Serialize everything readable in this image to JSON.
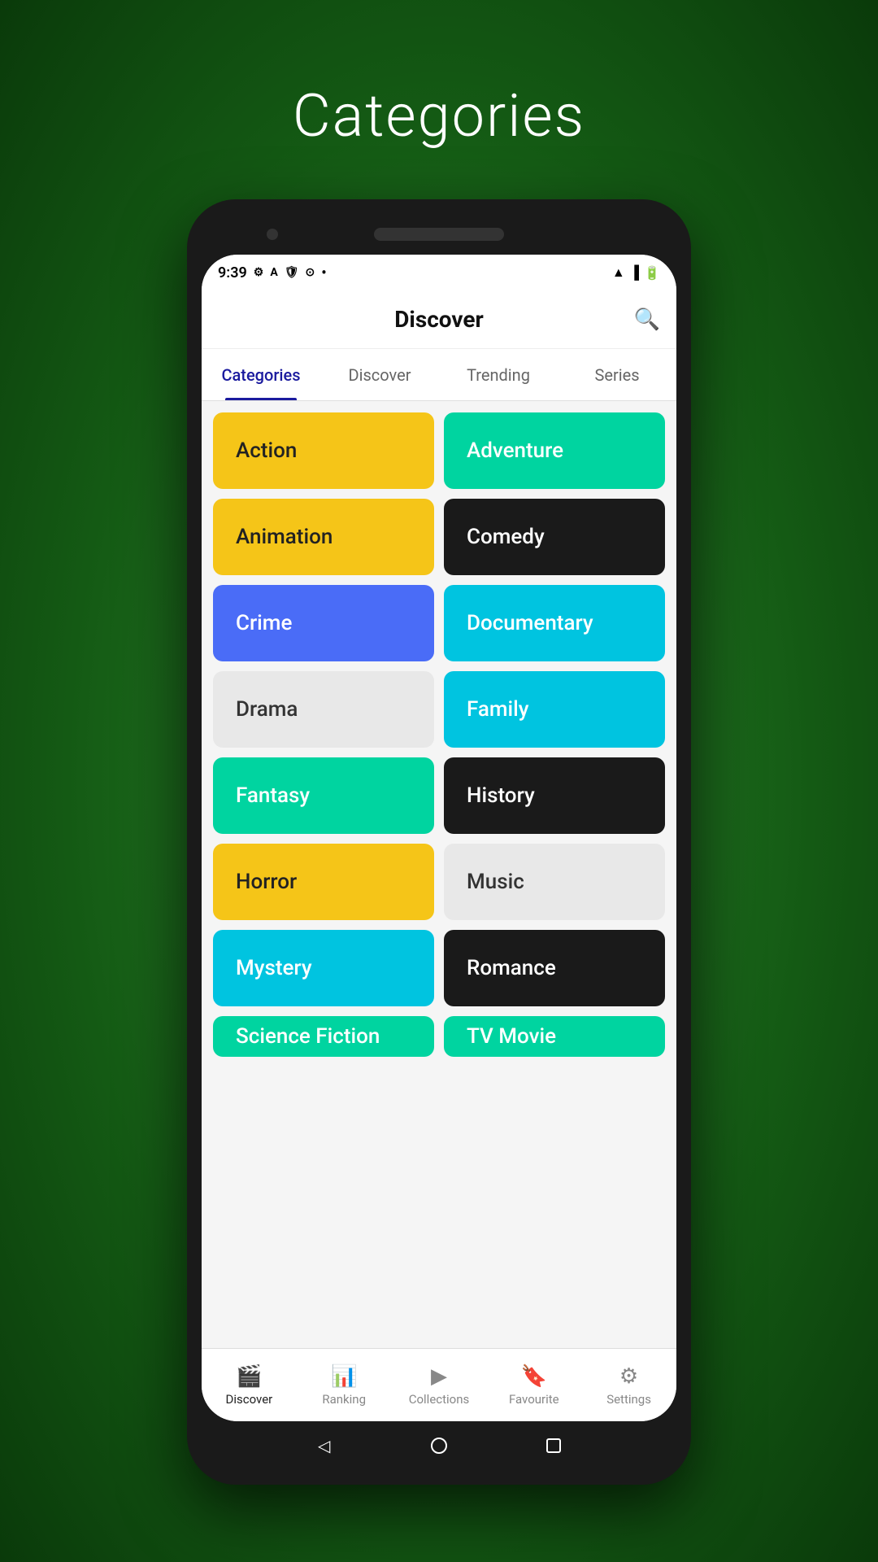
{
  "page": {
    "title": "Categories",
    "background_color": "#1a6e1a"
  },
  "app": {
    "header_title": "Discover",
    "search_icon": "🔍"
  },
  "status_bar": {
    "time": "9:39",
    "dot": "•"
  },
  "tabs": [
    {
      "label": "Categories",
      "active": true
    },
    {
      "label": "Discover",
      "active": false
    },
    {
      "label": "Trending",
      "active": false
    },
    {
      "label": "Series",
      "active": false
    }
  ],
  "categories": [
    {
      "label": "Action",
      "color_class": "yellow",
      "row": 0,
      "col": 0
    },
    {
      "label": "Adventure",
      "color_class": "teal",
      "row": 0,
      "col": 1
    },
    {
      "label": "Animation",
      "color_class": "yellow",
      "row": 1,
      "col": 0
    },
    {
      "label": "Comedy",
      "color_class": "black",
      "row": 1,
      "col": 1
    },
    {
      "label": "Crime",
      "color_class": "blue",
      "row": 2,
      "col": 0
    },
    {
      "label": "Documentary",
      "color_class": "cyan",
      "row": 2,
      "col": 1
    },
    {
      "label": "Drama",
      "color_class": "light",
      "row": 3,
      "col": 0
    },
    {
      "label": "Family",
      "color_class": "cyan",
      "row": 3,
      "col": 1
    },
    {
      "label": "Fantasy",
      "color_class": "teal",
      "row": 4,
      "col": 0
    },
    {
      "label": "History",
      "color_class": "black",
      "row": 4,
      "col": 1
    },
    {
      "label": "Horror",
      "color_class": "yellow",
      "row": 5,
      "col": 0
    },
    {
      "label": "Music",
      "color_class": "light",
      "row": 5,
      "col": 1
    },
    {
      "label": "Mystery",
      "color_class": "cyan",
      "row": 6,
      "col": 0
    },
    {
      "label": "Romance",
      "color_class": "black",
      "row": 6,
      "col": 1
    },
    {
      "label": "Science Fiction",
      "color_class": "teal",
      "row": 7,
      "col": 0
    },
    {
      "label": "TV Movie",
      "color_class": "teal",
      "row": 7,
      "col": 1
    }
  ],
  "bottom_nav": [
    {
      "label": "Discover",
      "icon": "🎬",
      "active": true
    },
    {
      "label": "Ranking",
      "icon": "📊",
      "active": false
    },
    {
      "label": "Collections",
      "icon": "▶",
      "active": false
    },
    {
      "label": "Favourite",
      "icon": "🔖",
      "active": false
    },
    {
      "label": "Settings",
      "icon": "⚙",
      "active": false
    }
  ]
}
